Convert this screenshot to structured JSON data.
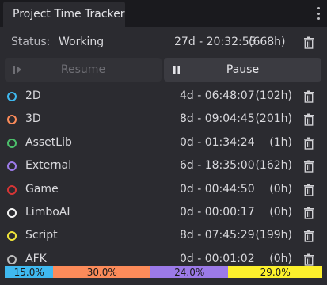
{
  "tab": {
    "title": "Project Time Tracker"
  },
  "status": {
    "label": "Status:",
    "value": "Working",
    "time": "27d - 20:32:55",
    "hours": "(668h)"
  },
  "buttons": {
    "resume": "Resume",
    "pause": "Pause"
  },
  "rows": [
    {
      "name": "2D",
      "time": "4d - 06:48:07",
      "hours": "(102h)",
      "color": "#3fb9f0"
    },
    {
      "name": "3D",
      "time": "8d - 09:04:45",
      "hours": "(201h)",
      "color": "#fc8b5a"
    },
    {
      "name": "AssetLib",
      "time": "0d - 01:34:24",
      "hours": "(1h)",
      "color": "#4cbf6b"
    },
    {
      "name": "External",
      "time": "6d - 18:35:00",
      "hours": "(162h)",
      "color": "#9c7ae8"
    },
    {
      "name": "Game",
      "time": "0d - 00:44:50",
      "hours": "(0h)",
      "color": "#d63535"
    },
    {
      "name": "LimboAI",
      "time": "0d - 00:00:17",
      "hours": "(0h)",
      "color": "#f4f4f4"
    },
    {
      "name": "Script",
      "time": "8d - 07:45:29",
      "hours": "(199h)",
      "color": "#f0e43a"
    },
    {
      "name": "AFK",
      "time": "0d - 00:01:02",
      "hours": "(0h)",
      "color": "#bdbdbd"
    }
  ],
  "breakdown": [
    {
      "label": "15.0%",
      "value": 15.0,
      "color": "#3fb9f0"
    },
    {
      "label": "30.0%",
      "value": 30.0,
      "color": "#fc8b5a"
    },
    {
      "label": "24.0%",
      "value": 24.0,
      "color": "#9c7ae8"
    },
    {
      "label": "29.0%",
      "value": 29.0,
      "color": "#fcf02c"
    }
  ]
}
